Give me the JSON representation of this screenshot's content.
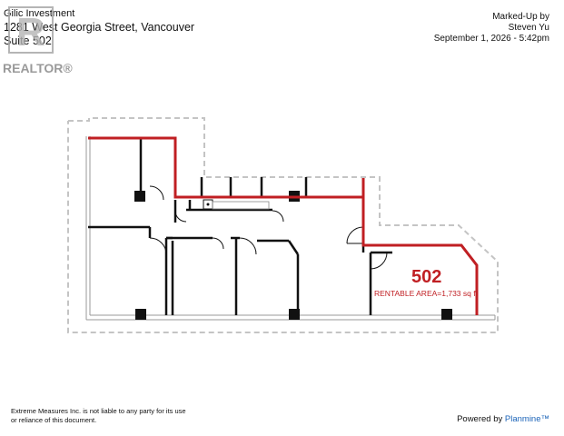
{
  "header": {
    "owner": "Gilic Investment",
    "address": "1281 West Georgia Street, Vancouver",
    "suite": "Suite 502"
  },
  "markup": {
    "line1": "Marked-Up by",
    "line2": "Steven Yu",
    "line3": "September 1, 2026 - 5:42pm"
  },
  "watermark": {
    "text": "REALTOR®",
    "color": "#9a9a9a"
  },
  "unit": {
    "number": "502",
    "area_label": "RENTABLE AREA=1,733 sq ft",
    "accent_color": "#c01f23"
  },
  "footer": {
    "disclaimer_line1": "Extreme Measures Inc. is not liable to any party for its use",
    "disclaimer_line2": "or reliance of this document.",
    "powered_prefix": "Powered by",
    "powered_brand": "Planmine™",
    "brand_color": "#1a63b8"
  }
}
